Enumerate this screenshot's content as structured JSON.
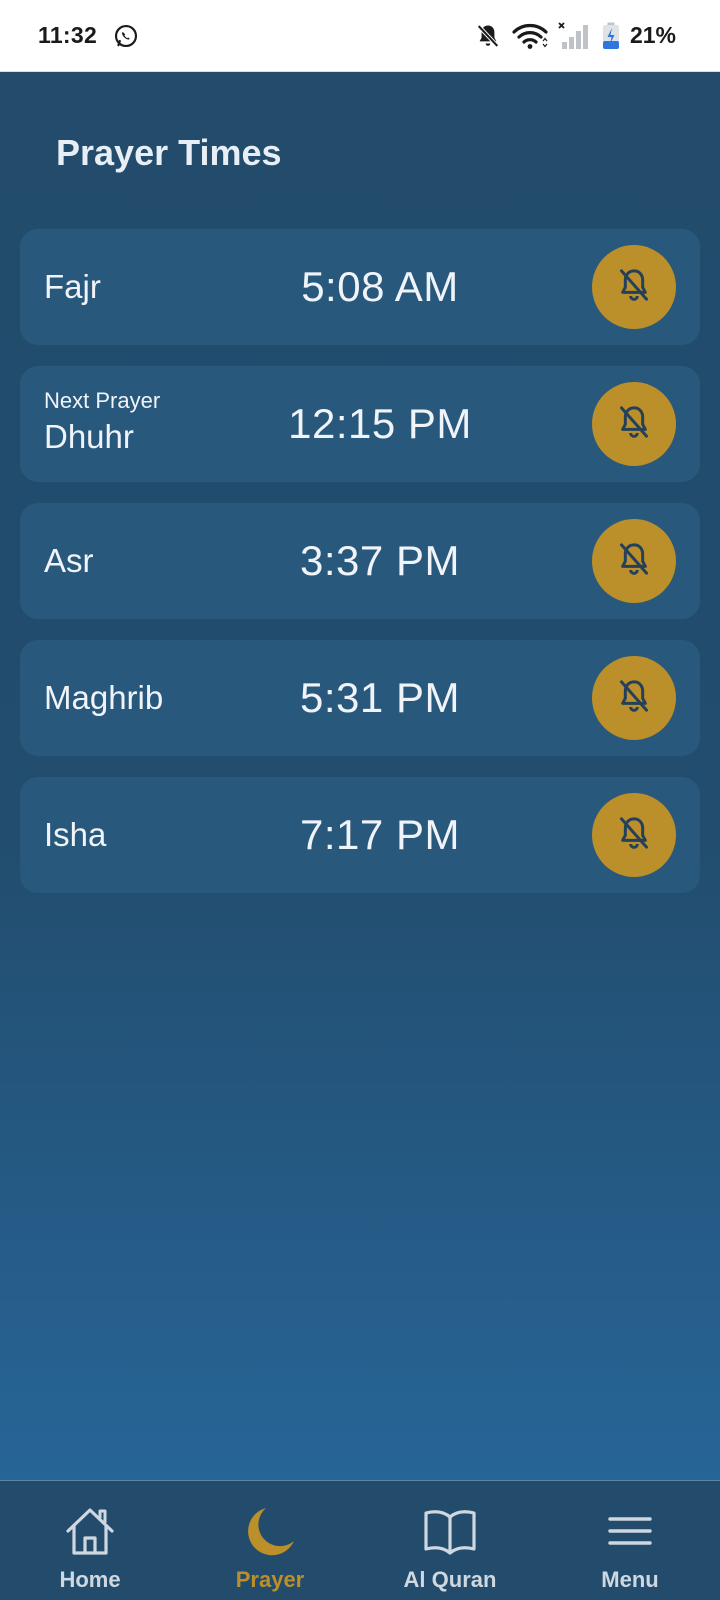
{
  "status_bar": {
    "time": "11:32",
    "battery": "21%",
    "icons": [
      "whatsapp-icon",
      "bell-off-icon",
      "wifi-icon",
      "signal-icon",
      "battery-icon"
    ]
  },
  "page": {
    "title": "Prayer Times"
  },
  "prayers": [
    {
      "name": "Fajr",
      "time": "5:08 AM",
      "alarm_icon": "bell-off-icon"
    },
    {
      "name": "Dhuhr",
      "time": "12:15 PM",
      "label": "Next Prayer",
      "alarm_icon": "bell-off-icon"
    },
    {
      "name": "Asr",
      "time": "3:37 PM",
      "alarm_icon": "bell-off-icon"
    },
    {
      "name": "Maghrib",
      "time": "5:31 PM",
      "alarm_icon": "bell-off-icon"
    },
    {
      "name": "Isha",
      "time": "7:17 PM",
      "alarm_icon": "bell-off-icon"
    }
  ],
  "bottom_nav": {
    "items": [
      {
        "label": "Home",
        "icon": "home-icon",
        "active": false
      },
      {
        "label": "Prayer",
        "icon": "moon-icon",
        "active": true
      },
      {
        "label": "Al Quran",
        "icon": "book-icon",
        "active": false
      },
      {
        "label": "Menu",
        "icon": "menu-icon",
        "active": false
      }
    ]
  },
  "colors": {
    "background_top": "#224b6c",
    "background_bottom": "#276597",
    "card": "#29587d",
    "accent_gold": "#bb8f2a",
    "text": "#f0f4f8"
  }
}
